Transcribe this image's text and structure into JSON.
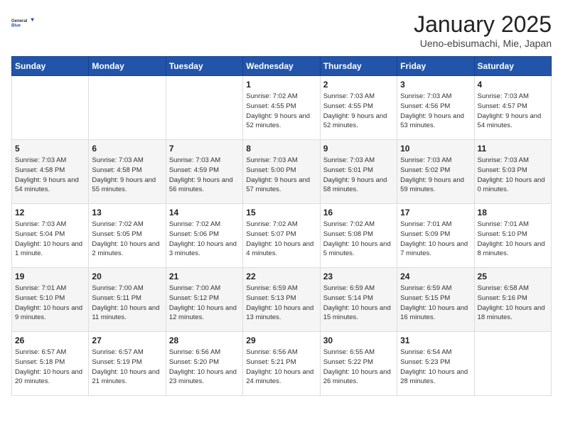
{
  "header": {
    "logo_general": "General",
    "logo_blue": "Blue",
    "month_title": "January 2025",
    "subtitle": "Ueno-ebisumachi, Mie, Japan"
  },
  "days_of_week": [
    "Sunday",
    "Monday",
    "Tuesday",
    "Wednesday",
    "Thursday",
    "Friday",
    "Saturday"
  ],
  "weeks": [
    [
      {
        "day": null
      },
      {
        "day": null
      },
      {
        "day": null
      },
      {
        "day": 1,
        "sunrise": "7:02 AM",
        "sunset": "4:55 PM",
        "daylight": "9 hours and 52 minutes."
      },
      {
        "day": 2,
        "sunrise": "7:03 AM",
        "sunset": "4:55 PM",
        "daylight": "9 hours and 52 minutes."
      },
      {
        "day": 3,
        "sunrise": "7:03 AM",
        "sunset": "4:56 PM",
        "daylight": "9 hours and 53 minutes."
      },
      {
        "day": 4,
        "sunrise": "7:03 AM",
        "sunset": "4:57 PM",
        "daylight": "9 hours and 54 minutes."
      }
    ],
    [
      {
        "day": 5,
        "sunrise": "7:03 AM",
        "sunset": "4:58 PM",
        "daylight": "9 hours and 54 minutes."
      },
      {
        "day": 6,
        "sunrise": "7:03 AM",
        "sunset": "4:58 PM",
        "daylight": "9 hours and 55 minutes."
      },
      {
        "day": 7,
        "sunrise": "7:03 AM",
        "sunset": "4:59 PM",
        "daylight": "9 hours and 56 minutes."
      },
      {
        "day": 8,
        "sunrise": "7:03 AM",
        "sunset": "5:00 PM",
        "daylight": "9 hours and 57 minutes."
      },
      {
        "day": 9,
        "sunrise": "7:03 AM",
        "sunset": "5:01 PM",
        "daylight": "9 hours and 58 minutes."
      },
      {
        "day": 10,
        "sunrise": "7:03 AM",
        "sunset": "5:02 PM",
        "daylight": "9 hours and 59 minutes."
      },
      {
        "day": 11,
        "sunrise": "7:03 AM",
        "sunset": "5:03 PM",
        "daylight": "10 hours and 0 minutes."
      }
    ],
    [
      {
        "day": 12,
        "sunrise": "7:03 AM",
        "sunset": "5:04 PM",
        "daylight": "10 hours and 1 minute."
      },
      {
        "day": 13,
        "sunrise": "7:02 AM",
        "sunset": "5:05 PM",
        "daylight": "10 hours and 2 minutes."
      },
      {
        "day": 14,
        "sunrise": "7:02 AM",
        "sunset": "5:06 PM",
        "daylight": "10 hours and 3 minutes."
      },
      {
        "day": 15,
        "sunrise": "7:02 AM",
        "sunset": "5:07 PM",
        "daylight": "10 hours and 4 minutes."
      },
      {
        "day": 16,
        "sunrise": "7:02 AM",
        "sunset": "5:08 PM",
        "daylight": "10 hours and 5 minutes."
      },
      {
        "day": 17,
        "sunrise": "7:01 AM",
        "sunset": "5:09 PM",
        "daylight": "10 hours and 7 minutes."
      },
      {
        "day": 18,
        "sunrise": "7:01 AM",
        "sunset": "5:10 PM",
        "daylight": "10 hours and 8 minutes."
      }
    ],
    [
      {
        "day": 19,
        "sunrise": "7:01 AM",
        "sunset": "5:10 PM",
        "daylight": "10 hours and 9 minutes."
      },
      {
        "day": 20,
        "sunrise": "7:00 AM",
        "sunset": "5:11 PM",
        "daylight": "10 hours and 11 minutes."
      },
      {
        "day": 21,
        "sunrise": "7:00 AM",
        "sunset": "5:12 PM",
        "daylight": "10 hours and 12 minutes."
      },
      {
        "day": 22,
        "sunrise": "6:59 AM",
        "sunset": "5:13 PM",
        "daylight": "10 hours and 13 minutes."
      },
      {
        "day": 23,
        "sunrise": "6:59 AM",
        "sunset": "5:14 PM",
        "daylight": "10 hours and 15 minutes."
      },
      {
        "day": 24,
        "sunrise": "6:59 AM",
        "sunset": "5:15 PM",
        "daylight": "10 hours and 16 minutes."
      },
      {
        "day": 25,
        "sunrise": "6:58 AM",
        "sunset": "5:16 PM",
        "daylight": "10 hours and 18 minutes."
      }
    ],
    [
      {
        "day": 26,
        "sunrise": "6:57 AM",
        "sunset": "5:18 PM",
        "daylight": "10 hours and 20 minutes."
      },
      {
        "day": 27,
        "sunrise": "6:57 AM",
        "sunset": "5:19 PM",
        "daylight": "10 hours and 21 minutes."
      },
      {
        "day": 28,
        "sunrise": "6:56 AM",
        "sunset": "5:20 PM",
        "daylight": "10 hours and 23 minutes."
      },
      {
        "day": 29,
        "sunrise": "6:56 AM",
        "sunset": "5:21 PM",
        "daylight": "10 hours and 24 minutes."
      },
      {
        "day": 30,
        "sunrise": "6:55 AM",
        "sunset": "5:22 PM",
        "daylight": "10 hours and 26 minutes."
      },
      {
        "day": 31,
        "sunrise": "6:54 AM",
        "sunset": "5:23 PM",
        "daylight": "10 hours and 28 minutes."
      },
      {
        "day": null
      }
    ]
  ]
}
